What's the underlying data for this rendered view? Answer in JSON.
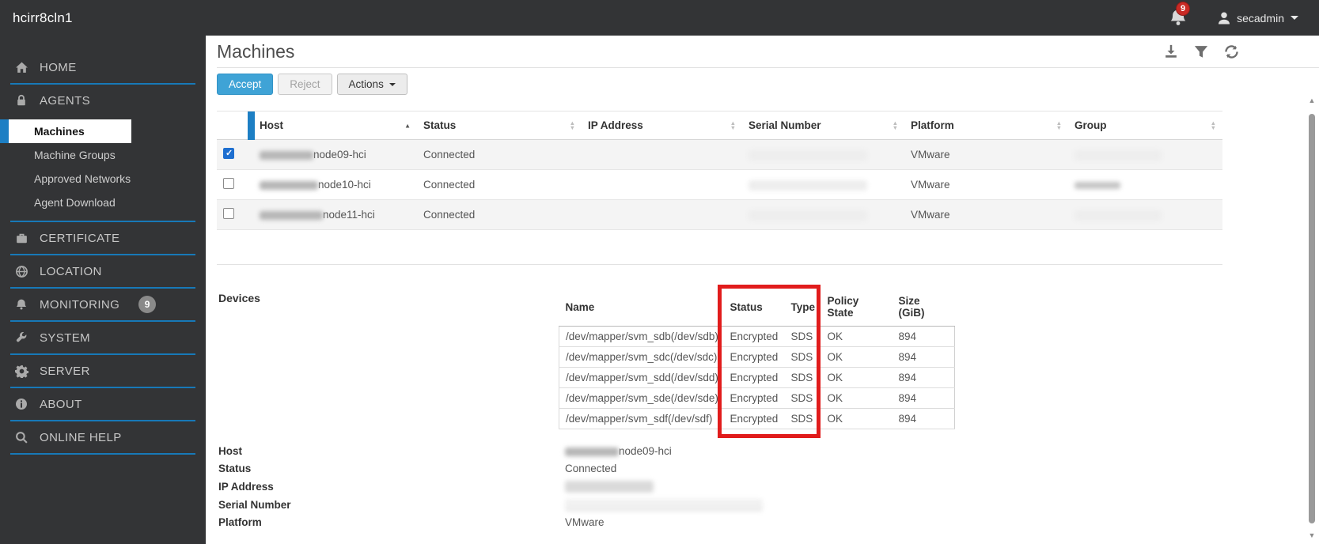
{
  "topbar": {
    "brand": "hcirr8cln1",
    "notification_count": "9",
    "username": "secadmin"
  },
  "sidebar": {
    "home": "HOME",
    "agents": "AGENTS",
    "agents_sub": {
      "machines": "Machines",
      "machine_groups": "Machine Groups",
      "approved_networks": "Approved Networks",
      "agent_download": "Agent Download"
    },
    "certificate": "CERTIFICATE",
    "location": "LOCATION",
    "monitoring": "MONITORING",
    "monitoring_badge": "9",
    "system": "SYSTEM",
    "server": "SERVER",
    "about": "ABOUT",
    "online_help": "ONLINE HELP"
  },
  "page": {
    "title": "Machines"
  },
  "toolbar": {
    "accept": "Accept",
    "reject": "Reject",
    "actions": "Actions"
  },
  "machines_table": {
    "columns": [
      "Host",
      "Status",
      "IP Address",
      "Serial Number",
      "Platform",
      "Group"
    ],
    "sorted_column": "Host",
    "sort_direction": "asc",
    "rows": [
      {
        "host": "node09-hci",
        "status": "Connected",
        "platform": "VMware",
        "checked": true
      },
      {
        "host": "node10-hci",
        "status": "Connected",
        "platform": "VMware",
        "checked": false
      },
      {
        "host": "node11-hci",
        "status": "Connected",
        "platform": "VMware",
        "checked": false
      }
    ]
  },
  "devices": {
    "label": "Devices",
    "columns": [
      "Name",
      "Status",
      "Type",
      "Policy State",
      "Size (GiB)"
    ],
    "rows": [
      {
        "name": "/dev/mapper/svm_sdb(/dev/sdb)",
        "status": "Encrypted",
        "type": "SDS",
        "policy_state": "OK",
        "size": "894"
      },
      {
        "name": "/dev/mapper/svm_sdc(/dev/sdc)",
        "status": "Encrypted",
        "type": "SDS",
        "policy_state": "OK",
        "size": "894"
      },
      {
        "name": "/dev/mapper/svm_sdd(/dev/sdd)",
        "status": "Encrypted",
        "type": "SDS",
        "policy_state": "OK",
        "size": "894"
      },
      {
        "name": "/dev/mapper/svm_sde(/dev/sde)",
        "status": "Encrypted",
        "type": "SDS",
        "policy_state": "OK",
        "size": "894"
      },
      {
        "name": "/dev/mapper/svm_sdf(/dev/sdf)",
        "status": "Encrypted",
        "type": "SDS",
        "policy_state": "OK",
        "size": "894"
      }
    ],
    "annotation": {
      "type": "red-box",
      "highlighted_columns": [
        "Status",
        "Type"
      ],
      "color": "#e11c1c"
    }
  },
  "details": {
    "rows": [
      {
        "label": "Host",
        "value": "node09-hci"
      },
      {
        "label": "Status",
        "value": "Connected"
      },
      {
        "label": "IP Address",
        "value": ""
      },
      {
        "label": "Serial Number",
        "value": ""
      },
      {
        "label": "Platform",
        "value": "VMware"
      }
    ]
  },
  "icons": {
    "topbar": [
      "bell-icon",
      "user-icon",
      "chevron-down-icon"
    ],
    "sidebar": [
      "home-icon",
      "lock-icon",
      "certificate-icon",
      "globe-icon",
      "bell-icon",
      "wrench-icon",
      "gear-icon",
      "info-icon",
      "search-icon"
    ],
    "title_row": [
      "download-icon",
      "filter-icon",
      "refresh-icon"
    ]
  },
  "colors": {
    "accent_blue": "#3fa3d6",
    "sidebar_divider_blue": "#1779b8",
    "active_item_bar_blue": "#1d7fc4",
    "annotation_red": "#e11c1c",
    "badge_red": "#c92a25",
    "dark_chrome": "#333436"
  }
}
